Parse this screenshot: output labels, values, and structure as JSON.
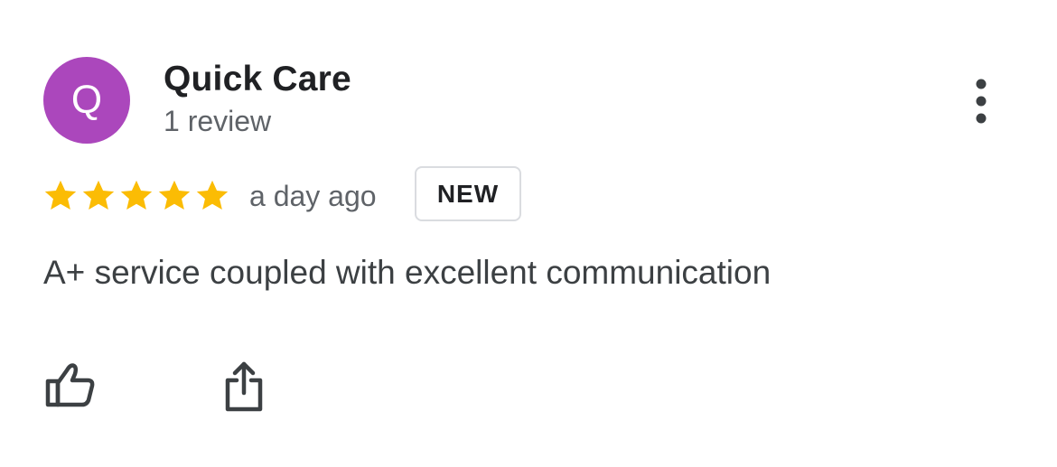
{
  "review": {
    "author": {
      "initial": "Q",
      "name": "Quick Care",
      "review_count": "1 review",
      "avatar_color": "#ab47bc"
    },
    "rating": 5,
    "max_rating": 5,
    "star_color": "#fbbc04",
    "timestamp": "a day ago",
    "badge": "NEW",
    "text": "A+ service coupled with excellent communication"
  },
  "icons": {
    "more": "more-vertical-icon",
    "star": "star-icon",
    "like": "thumbs-up-icon",
    "share": "share-icon"
  }
}
